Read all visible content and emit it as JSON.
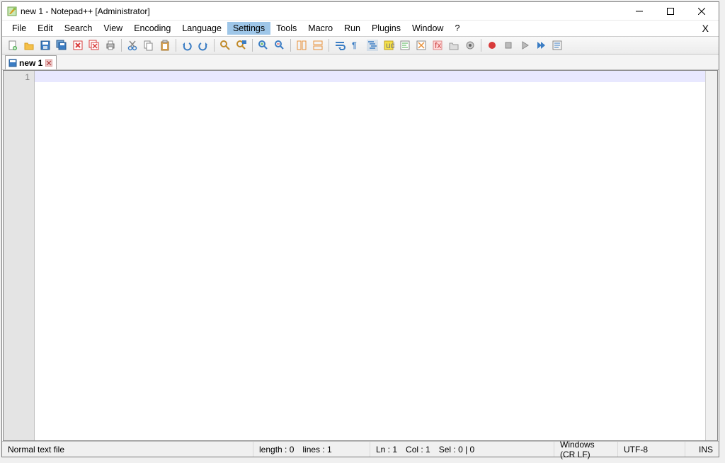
{
  "title": "new 1 - Notepad++ [Administrator]",
  "menu": {
    "file": "File",
    "edit": "Edit",
    "search": "Search",
    "view": "View",
    "encoding": "Encoding",
    "language": "Language",
    "settings": "Settings",
    "tools": "Tools",
    "macro": "Macro",
    "run": "Run",
    "plugins": "Plugins",
    "window": "Window",
    "help": "?"
  },
  "tab": {
    "label": "new 1"
  },
  "gutter": {
    "line1": "1"
  },
  "status": {
    "filetype": "Normal text file",
    "length": "length : 0",
    "lines": "lines : 1",
    "ln": "Ln : 1",
    "col": "Col : 1",
    "sel": "Sel : 0 | 0",
    "eol": "Windows (CR LF)",
    "encoding": "UTF-8",
    "mode": "INS"
  },
  "colors": {
    "folder": "#f4c04a",
    "folder_dark": "#d99b1a",
    "blue": "#3b7dc4",
    "green": "#4caf50",
    "red": "#d83b3b",
    "purple": "#7a4fbf",
    "orange": "#e8913a",
    "grey": "#888"
  }
}
